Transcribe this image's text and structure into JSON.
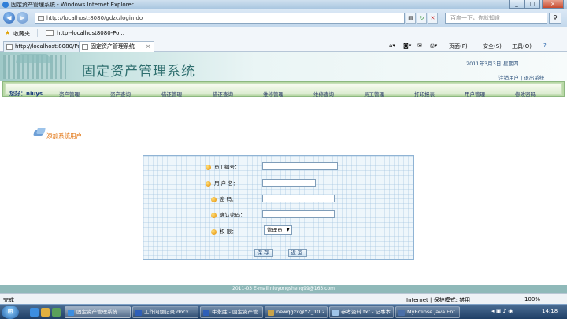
{
  "window": {
    "title": "固定资产管理系统 - Windows Internet Explorer"
  },
  "addressbar": {
    "url": "http://localhost:8080/gdzc/login.do",
    "search_placeholder": "百度一下，你就知道"
  },
  "favorites": {
    "label": "收藏夹",
    "item": "http--localhost8080-Po..."
  },
  "tabs": [
    {
      "label": "http://localhost:8080/Po...",
      "active": false
    },
    {
      "label": "固定资产管理系统",
      "active": true
    }
  ],
  "commands": {
    "page": "页面(P)",
    "safety": "安全(S)",
    "tools": "工具(O)",
    "help": "?"
  },
  "app": {
    "title": "固定资产管理系统",
    "date": "2011年3月3日",
    "weekday": "星期四",
    "logout": "注销用户",
    "exit": "退出系统",
    "welcome": "您好：niuys",
    "nav": [
      "资产管理",
      "资产查询",
      "借还管理",
      "借还查询",
      "维修管理",
      "维修查询",
      "员工管理",
      "打印报表",
      "用户管理",
      "修改密码"
    ],
    "page_title": "添加系统用户",
    "form": {
      "emp_no": "员工编号：",
      "username": "用 户 名：",
      "password": "密    码：",
      "confirm": "确认密码：",
      "permission": "权    限：",
      "role_value": "管理员",
      "save": "保存",
      "back": "返回"
    },
    "footer": "2011-03 E-mail:niuyongsheng99@163.com"
  },
  "statusbar": {
    "left": "完成",
    "zone": "Internet | 保护模式: 禁用",
    "zoom": "100%"
  },
  "taskbar": {
    "items": [
      "固定资产管理系统 ...",
      "工作问题记录.docx ...",
      "牛永胜 - 固定资产管...",
      "newqgzx@YZ_10.2...",
      "参考资料.txt - 记事本",
      "MyEclipse Java Ent..."
    ],
    "clock": "14:18"
  },
  "colors": {
    "accent_orange": "#e06b00",
    "nav_green": "#b9d9a6",
    "header_teal": "#2f6f6f"
  }
}
